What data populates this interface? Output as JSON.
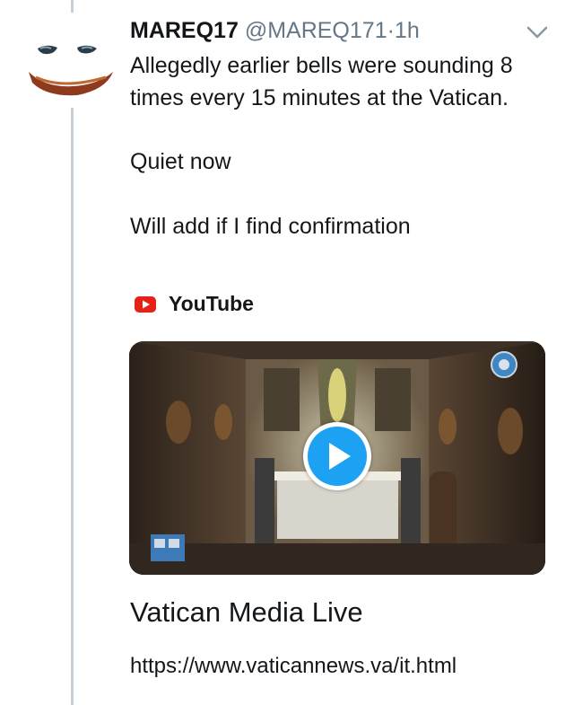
{
  "tweet": {
    "display_name": "MAREQ17",
    "handle": "@MAREQ171",
    "separator": "·",
    "time": "1h",
    "lines": [
      "Allegedly earlier bells were sounding 8 times every 15 minutes at the Vatican.",
      "Quiet now",
      "Will add if I find confirmation"
    ],
    "menu_icon": "chevron-down-icon",
    "avatar_icon": "joker-face-avatar"
  },
  "card": {
    "source_icon": "youtube-icon",
    "source_label": "YouTube",
    "title": "Vatican Media Live",
    "url": "https://www.vaticannews.va/it.html",
    "play_icon": "play-icon"
  },
  "colors": {
    "accent": "#1da1f2",
    "youtube_red": "#e62117",
    "muted_text": "#657786",
    "thread_line": "#c4cfd6"
  }
}
